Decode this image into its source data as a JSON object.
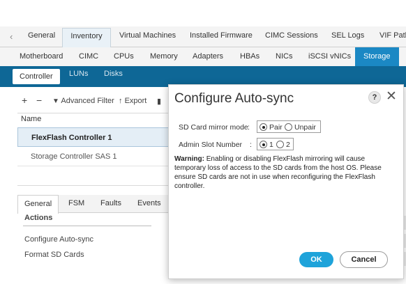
{
  "top_tabs": [
    "General",
    "Inventory",
    "Virtual Machines",
    "Installed Firmware",
    "CIMC Sessions",
    "SEL Logs",
    "VIF Paths"
  ],
  "sub_tabs": [
    "Motherboard",
    "CIMC",
    "CPUs",
    "Memory",
    "Adapters",
    "HBAs",
    "NICs",
    "iSCSI vNICs",
    "Storage"
  ],
  "band_tabs": [
    "Controller",
    "LUNs",
    "Disks"
  ],
  "toolbar": {
    "add": "+",
    "remove": "−",
    "advanced_filter": "Advanced Filter",
    "export": "Export"
  },
  "list": {
    "header": "Name",
    "rows": [
      "FlexFlash Controller 1",
      "Storage Controller SAS 1"
    ]
  },
  "bottom_tabs": [
    "General",
    "FSM",
    "Faults",
    "Events"
  ],
  "actions": {
    "heading": "Actions",
    "links": [
      "Configure Auto-sync",
      "Format SD Cards"
    ]
  },
  "dialog": {
    "title": "Configure Auto-sync",
    "help": "?",
    "close": "✕",
    "mirror_mode": {
      "label": "SD Card mirror mode",
      "colon": ":",
      "options": [
        "Pair",
        "Unpair"
      ],
      "selected": "Pair"
    },
    "admin_slot": {
      "label": "Admin Slot Number",
      "colon": ":",
      "options": [
        "1",
        "2"
      ],
      "selected": "1"
    },
    "warning_label": "Warning:",
    "warning_text": "Enabling or disabling FlexFlash mirroring will cause temporary loss of access to the SD cards from the host OS. Please ensure SD cards are not in use when reconfiguring the FlexFlash controller.",
    "ok": "OK",
    "cancel": "Cancel"
  },
  "colors": {
    "accent_blue": "#1b88c4",
    "band_blue": "#0e6796",
    "ok_blue": "#1ea3da"
  }
}
